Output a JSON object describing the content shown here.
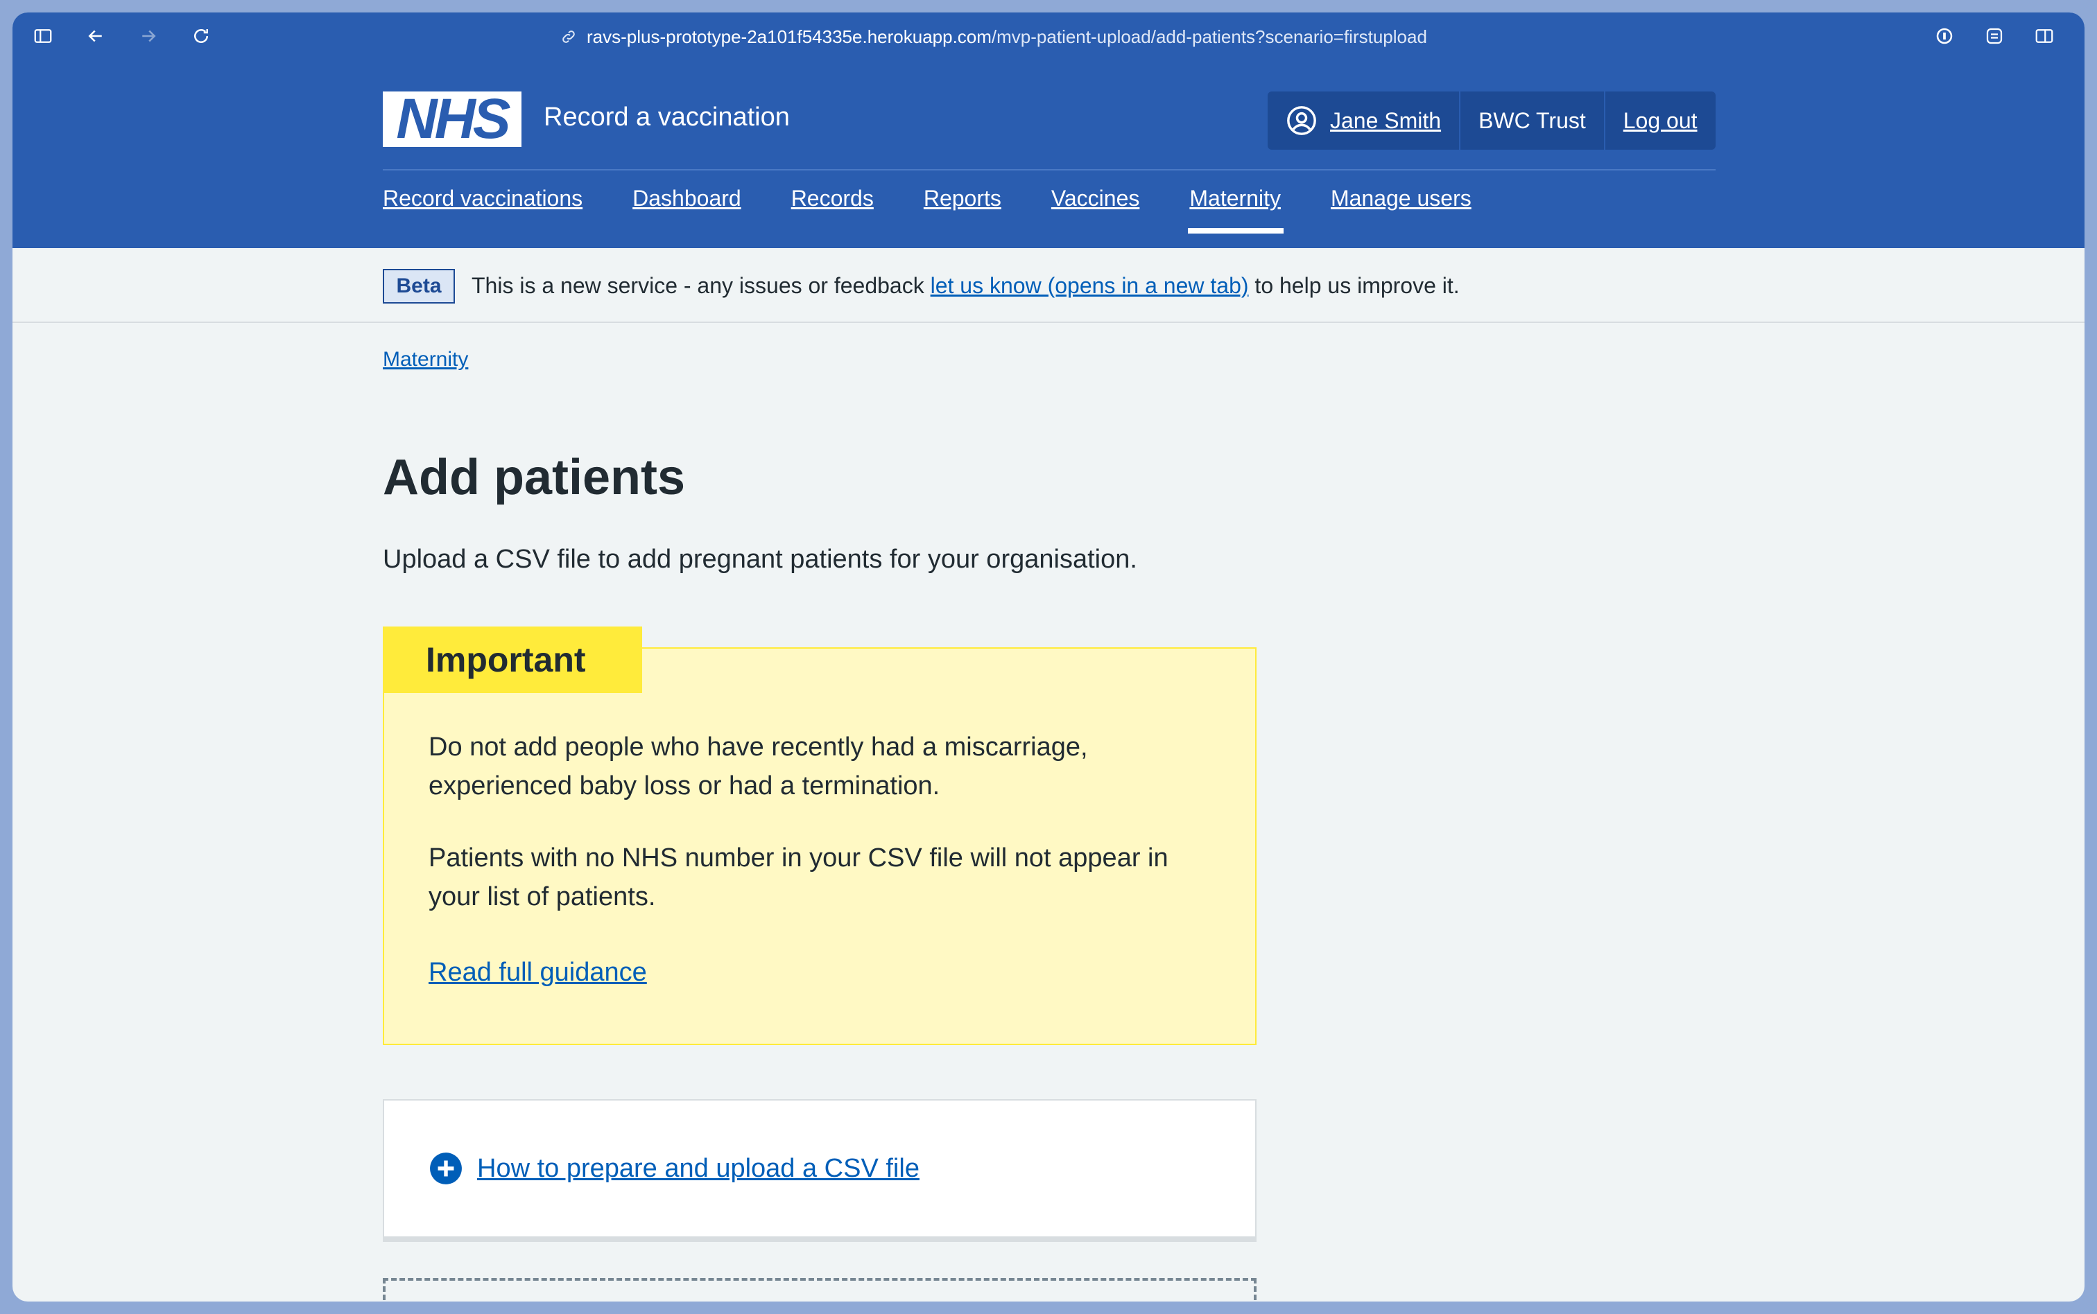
{
  "browser": {
    "url_host": "ravs-plus-prototype-2a101f54335e.herokuapp.com",
    "url_path": "/mvp-patient-upload/add-patients?scenario=firstupload"
  },
  "header": {
    "logo_text": "NHS",
    "service_name": "Record a vaccination",
    "user_name": "Jane Smith",
    "organisation": "BWC Trust",
    "logout_label": "Log out"
  },
  "nav": {
    "items": [
      {
        "label": "Record vaccinations"
      },
      {
        "label": "Dashboard"
      },
      {
        "label": "Records"
      },
      {
        "label": "Reports"
      },
      {
        "label": "Vaccines"
      },
      {
        "label": "Maternity",
        "active": true
      },
      {
        "label": "Manage users"
      }
    ]
  },
  "beta": {
    "tag": "Beta",
    "text_before": "This is a new service - any issues or feedback ",
    "link": "let us know (opens in a new tab)",
    "text_after": " to help us improve it."
  },
  "breadcrumb": "Maternity",
  "page": {
    "title": "Add patients",
    "lead": "Upload a CSV file to add pregnant patients for your organisation."
  },
  "important": {
    "label": "Important",
    "p1": "Do not add people who have recently had a miscarriage, experienced baby loss or had a termination.",
    "p2": "Patients with no NHS number in your CSV file will not appear in your list of patients.",
    "link": "Read full guidance"
  },
  "details": {
    "summary": "How to prepare and upload a CSV file"
  },
  "colors": {
    "nhs_blue": "#2a5db0",
    "link_blue": "#005eb8",
    "warning_yellow": "#ffeb3b",
    "warning_bg": "#fff9c4"
  }
}
